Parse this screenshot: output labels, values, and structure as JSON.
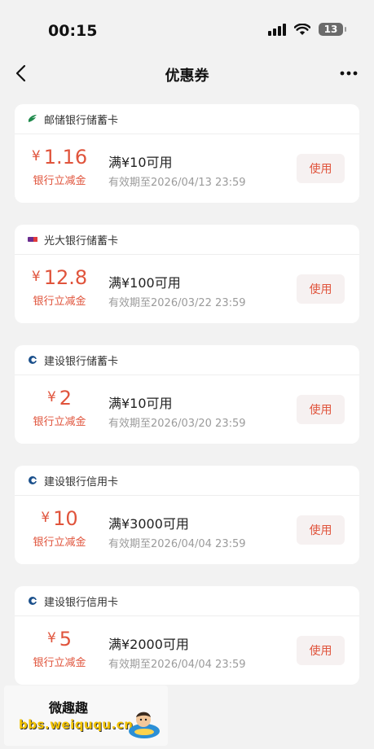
{
  "status_bar": {
    "time": "00:15",
    "battery": "13"
  },
  "nav": {
    "title": "优惠券"
  },
  "colors": {
    "accent": "#e0543c",
    "button_bg": "#f6f1f1",
    "page_bg": "#f2f2f2"
  },
  "coupons": [
    {
      "bank": "邮储银行储蓄卡",
      "logo": "psbc-logo-icon",
      "currency": "¥",
      "amount": "1.16",
      "amount_label": "银行立减金",
      "condition": "满¥10可用",
      "expiry": "有效期至2026/04/13 23:59",
      "button": "使用"
    },
    {
      "bank": "光大银行储蓄卡",
      "logo": "ceb-logo-icon",
      "currency": "¥",
      "amount": "12.8",
      "amount_label": "银行立减金",
      "condition": "满¥100可用",
      "expiry": "有效期至2026/03/22 23:59",
      "button": "使用"
    },
    {
      "bank": "建设银行储蓄卡",
      "logo": "ccb-logo-icon",
      "currency": "¥",
      "amount": "2",
      "amount_label": "银行立减金",
      "condition": "满¥10可用",
      "expiry": "有效期至2026/03/20 23:59",
      "button": "使用"
    },
    {
      "bank": "建设银行信用卡",
      "logo": "ccb-logo-icon",
      "currency": "¥",
      "amount": "10",
      "amount_label": "银行立减金",
      "condition": "满¥3000可用",
      "expiry": "有效期至2026/04/04 23:59",
      "button": "使用"
    },
    {
      "bank": "建设银行信用卡",
      "logo": "ccb-logo-icon",
      "currency": "¥",
      "amount": "5",
      "amount_label": "银行立减金",
      "condition": "满¥2000可用",
      "expiry": "有效期至2026/04/04 23:59",
      "button": "使用"
    }
  ],
  "watermark": {
    "title": "微趣趣",
    "url": "bbs.weiququ.cn"
  }
}
